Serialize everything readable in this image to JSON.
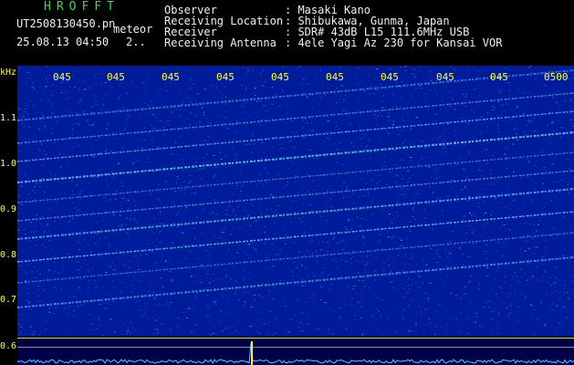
{
  "header": {
    "app_title": "HROFFT",
    "file_name": "UT2508130450.pn",
    "file_suffix": "meteor",
    "date_time": "25.08.13 04:50",
    "count": "2..",
    "info_labels": [
      "Observer",
      "Receiving Location",
      "Receiver",
      "Receiving Antenna"
    ],
    "info_values": [
      ": Masaki Kano",
      ": Shibukawa, Gunma, Japan",
      ": SDR# 43dB L15 111.6MHz USB",
      ": 4ele Yagi Az 230 for Kansai VOR"
    ]
  },
  "axis": {
    "unit": "kHz",
    "y_labels": [
      "1.1",
      "1.0",
      "0.9",
      "0.8",
      "0.7",
      "0.6"
    ],
    "x_labels": [
      "045",
      "045",
      "045",
      "045",
      "045",
      "045",
      "045",
      "045",
      "045",
      "0500"
    ]
  },
  "colors": {
    "background": "#001c9a",
    "streak": "#6ad8ff",
    "noise": "#2a5fd8",
    "label_yellow": "#ffff33",
    "title_green": "#33dd55"
  }
}
